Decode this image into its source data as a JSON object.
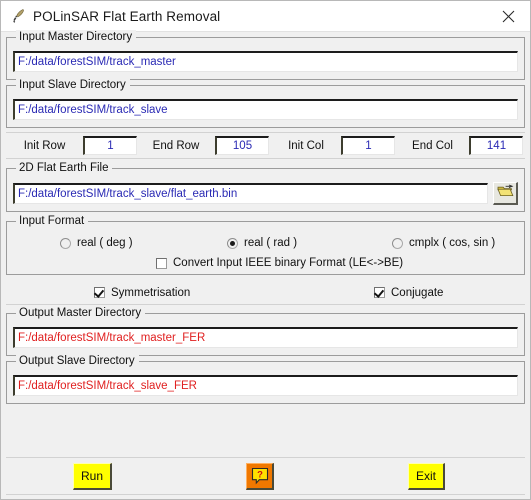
{
  "window": {
    "title": "POLinSAR Flat Earth Removal",
    "icon": "quill-pen-icon",
    "close_icon": "close-icon",
    "background_color": "#f0f0f0"
  },
  "colors": {
    "input_text": "#2a2ab4",
    "output_text": "#e02020",
    "button_face": "#ffff00",
    "help_button_face": "#f07800",
    "folder_icon": "#e8d24a"
  },
  "groups": {
    "input_master": {
      "title": "Input Master Directory",
      "value": "F:/data/forestSIM/track_master",
      "placeholder": ""
    },
    "input_slave": {
      "title": "Input Slave Directory",
      "value": "F:/data/forestSIM/track_slave",
      "placeholder": ""
    },
    "flat_earth_file": {
      "title": "2D Flat Earth File",
      "value": "F:/data/forestSIM/track_slave/flat_earth.bin",
      "placeholder": "",
      "browse_icon": "open-folder-icon"
    },
    "input_format": {
      "title": "Input Format",
      "options": [
        {
          "label": "real ( deg )",
          "selected": false
        },
        {
          "label": "real ( rad )",
          "selected": true
        },
        {
          "label": "cmplx ( cos, sin )",
          "selected": false
        }
      ],
      "convert_checkbox": {
        "label": "Convert Input IEEE binary Format (LE<->BE)",
        "checked": false
      }
    },
    "output_master": {
      "title": "Output Master Directory",
      "value": "F:/data/forestSIM/track_master_FER",
      "placeholder": ""
    },
    "output_slave": {
      "title": "Output Slave Directory",
      "value": "F:/data/forestSIM/track_slave_FER",
      "placeholder": ""
    }
  },
  "extents": {
    "init_row": {
      "label": "Init Row",
      "value": "1"
    },
    "end_row": {
      "label": "End Row",
      "value": "105"
    },
    "init_col": {
      "label": "Init Col",
      "value": "1"
    },
    "end_col": {
      "label": "End Col",
      "value": "141"
    }
  },
  "toggles": {
    "symmetrisation": {
      "label": "Symmetrisation",
      "checked": true
    },
    "conjugate": {
      "label": "Conjugate",
      "checked": true
    }
  },
  "buttons": {
    "run": "Run",
    "help": "?",
    "exit": "Exit"
  }
}
